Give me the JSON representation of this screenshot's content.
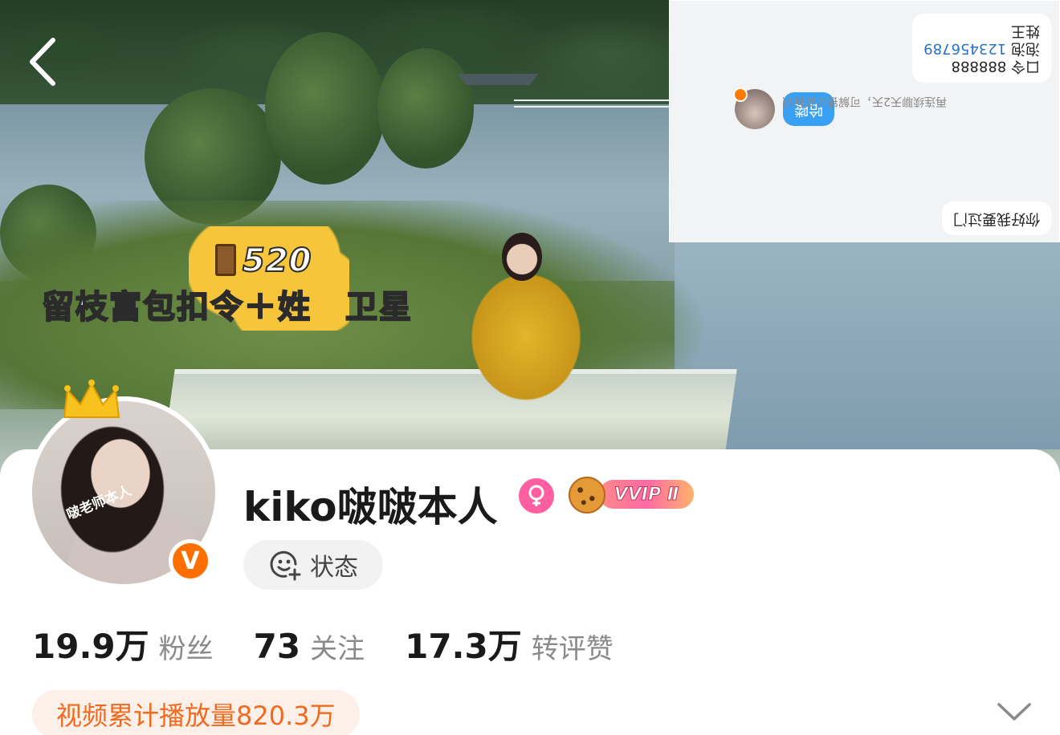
{
  "promo": {
    "number": "520",
    "slogan": "留枝富包扣令＋姓　卫星"
  },
  "chat_overlay": {
    "lines": [
      "你好我要过门",
      "哈喽",
      "再连续聊天2天，可解锁火花标识",
      "口令 888888",
      "泡泡 123456789",
      "姓王"
    ],
    "pin_label": "口令",
    "pin_value": "888888",
    "bubble_label": "泡泡",
    "bubble_value": "123456789",
    "surname": "姓王"
  },
  "profile": {
    "avatar_watermark": "啵老师本人",
    "verified_badge": "V",
    "name": "kiko啵啵本人",
    "vip_badge": "VVIP Ⅱ",
    "status_button": "状态"
  },
  "stats": [
    {
      "value": "19.9万",
      "label": "粉丝"
    },
    {
      "value": "73",
      "label": "关注"
    },
    {
      "value": "17.3万",
      "label": "转评赞"
    }
  ],
  "video_summary": "视频累计播放量820.3万",
  "colors": {
    "accent_orange": "#ff6f00",
    "video_pill_bg": "#fdf0e8",
    "video_pill_text": "#f06a20",
    "gender_pink": "#ff5fa0",
    "chat_blue": "#3aa0f3"
  },
  "icons": {
    "back": "chevron-left-icon",
    "status": "smiley-plus-icon",
    "gender": "female-icon",
    "expand": "chevron-down-icon"
  }
}
